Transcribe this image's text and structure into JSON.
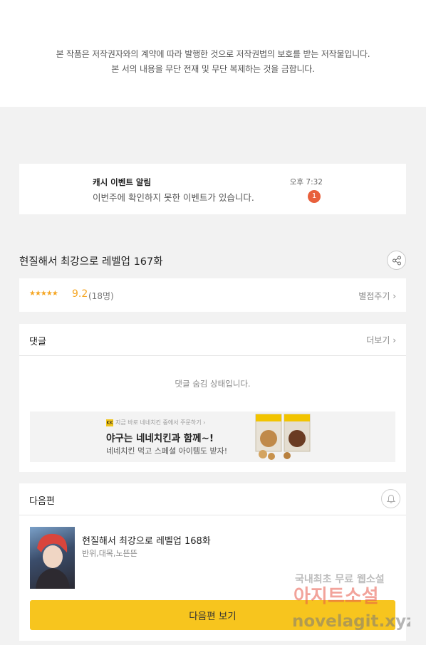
{
  "notice": {
    "line1": "본 작품은 저작권자와의 계약에 따라 발행한 것으로 저작권법의 보호를 받는 저작물입니다.",
    "line2": "본 서의 내용을 무단 전재 및 무단 복제하는 것을 금합니다."
  },
  "event": {
    "title": "캐시 이벤트 알림",
    "text": "이번주에 확인하지 못한 이벤트가 있습니다.",
    "time": "오후 7:32",
    "badge": "1"
  },
  "episode": {
    "title": "현질해서 최강으로 레벨업 167화",
    "share_icon": "share-icon"
  },
  "rating": {
    "stars": "★★★★★",
    "score": "9.2",
    "count": "(18명)",
    "rate_label": "별점주기 ›"
  },
  "comments": {
    "title": "댓글",
    "more_label": "더보기 ›",
    "hidden_message": "댓글 숨김 상태입니다."
  },
  "ad": {
    "logo": "KK",
    "small_text": "지금 바로 네네치킨 중에서 주문하기 ›",
    "headline": "야구는 네네치킨과 함께~!",
    "sub": "네네치킨 먹고 스페셜 아이템도 받자!"
  },
  "next": {
    "title": "다음편",
    "bell_icon": "bell-icon",
    "ep_title": "현질해서 최강으로 레벨업 168화",
    "authors": "반위,대목,노뜬뜬",
    "button_label": "다음편 보기"
  },
  "watermark": {
    "line1": "국내최초 무료 웹소설",
    "line2": "아지트소설",
    "line3": "novelagit.xyz"
  },
  "colors": {
    "accent": "#f7c51e",
    "star": "#f5a623",
    "badge": "#e8603c"
  }
}
